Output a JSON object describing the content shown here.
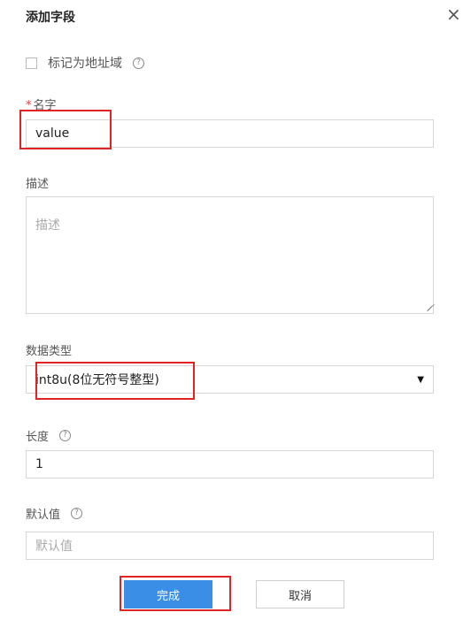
{
  "dialog": {
    "title": "添加字段",
    "close_glyph": "×"
  },
  "mark_address": {
    "label": "标记为地址域",
    "checked": false
  },
  "help_glyph": "?",
  "name": {
    "required_mark": "*",
    "label": "名字",
    "value": "value"
  },
  "description": {
    "label": "描述",
    "placeholder": "描述"
  },
  "data_type": {
    "label": "数据类型",
    "selected": "int8u(8位无符号整型)",
    "arrow": "▼"
  },
  "length": {
    "label": "长度",
    "value": "1"
  },
  "default_value": {
    "label": "默认值",
    "placeholder": "默认值"
  },
  "buttons": {
    "confirm": "完成",
    "cancel": "取消"
  },
  "colors": {
    "primary": "#3a8ee6",
    "highlight": "#e02424",
    "required": "#e4393c"
  },
  "icons": [
    "close-icon",
    "help-icon",
    "checkbox-icon",
    "dropdown-arrow-icon",
    "resize-handle-icon"
  ]
}
